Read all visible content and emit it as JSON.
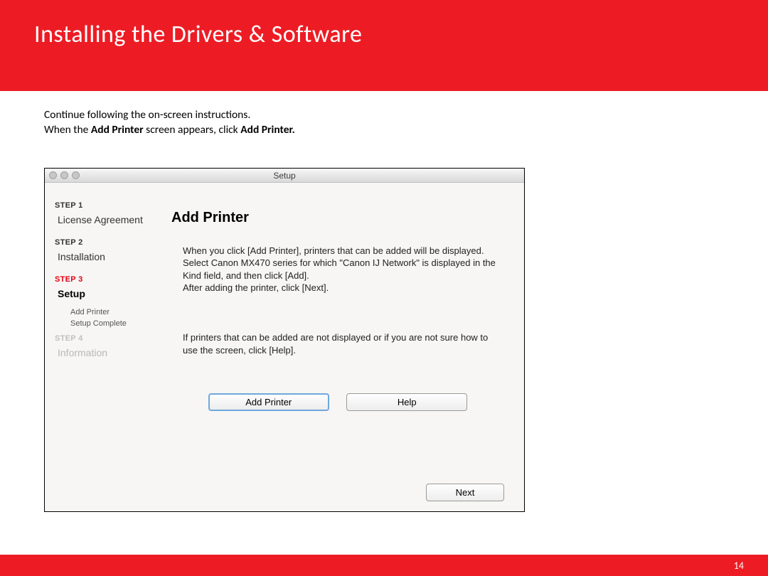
{
  "header": {
    "title": "Installing  the Drivers & Software"
  },
  "instructions": {
    "line1": "Continue following the on-screen instructions.",
    "line2_pre": "When the ",
    "line2_b1": "Add Printer",
    "line2_mid": " screen appears, click ",
    "line2_b2": "Add Printer."
  },
  "window": {
    "title": "Setup",
    "sidebar": {
      "step1_label": "STEP 1",
      "step1_title": "License Agreement",
      "step2_label": "STEP 2",
      "step2_title": "Installation",
      "step3_label": "STEP 3",
      "step3_title": "Setup",
      "step3_sub1": "Add Printer",
      "step3_sub2": "Setup Complete",
      "step4_label": "STEP 4",
      "step4_title": "Information"
    },
    "content": {
      "heading": "Add Printer",
      "para1": "When you click [Add Printer], printers that can be added will be displayed. Select Canon  MX470 series for which \"Canon IJ Network\" is displayed in the Kind field, and then click [Add].\nAfter adding the printer, click [Next].",
      "para2": "If printers that can be added are not displayed or if you are not sure how to use the screen, click [Help].",
      "btn_add": "Add Printer",
      "btn_help": "Help",
      "btn_next": "Next"
    }
  },
  "page_number": "14"
}
